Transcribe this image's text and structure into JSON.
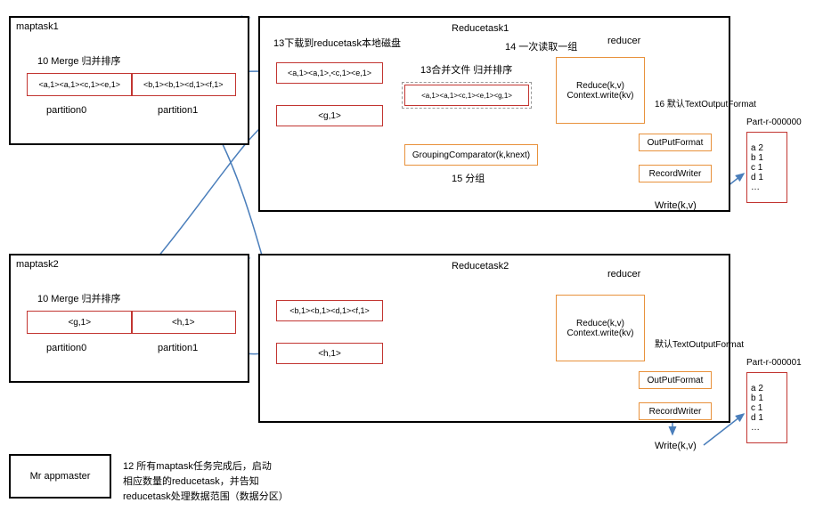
{
  "maptask1": {
    "title": "maptask1",
    "merge_label": "10 Merge 归并排序",
    "data0": "<a,1><a,1><c,1><e,1>",
    "data1": "<b,1><b,1><d,1><f,1>",
    "p0": "partition0",
    "p1": "partition1"
  },
  "maptask2": {
    "title": "maptask2",
    "merge_label": "10 Merge 归并排序",
    "data0": "<g,1>",
    "data1": "<h,1>",
    "p0": "partition0",
    "p1": "partition1"
  },
  "reducetask1": {
    "title": "Reducetask1",
    "l13a": "13下载到reducetask本地磁盘",
    "l14": "14 一次读取一组",
    "l13b": "13合并文件 归并排序",
    "d1": "<a,1><a,1>,<c,1><e,1>",
    "d2": "<g,1>",
    "merged": "<a,1><a,1><c,1><e,1><g,1>",
    "grouping": "GroupingComparator(k,knext)",
    "l15": "15 分组",
    "reducer_label": "reducer",
    "reduce1": "Reduce(k,v)",
    "reduce2": "Context.write(kv)",
    "l16": "16 默认TextOutputFormat",
    "opf": "OutPutFormat",
    "rw": "RecordWriter",
    "write": "Write(k,v)",
    "part": "Part-r-000000",
    "out": [
      "a 2",
      "b 1",
      "c 1",
      "d 1",
      "…"
    ]
  },
  "reducetask2": {
    "title": "Reducetask2",
    "d1": "<b,1><b,1><d,1><f,1>",
    "d2": "<h,1>",
    "reducer_label": "reducer",
    "reduce1": "Reduce(k,v)",
    "reduce2": "Context.write(kv)",
    "l16": "默认TextOutputFormat",
    "opf": "OutPutFormat",
    "rw": "RecordWriter",
    "write": "Write(k,v)",
    "part": "Part-r-000001",
    "out": [
      "a 2",
      "b 1",
      "c 1",
      "d 1",
      "…"
    ]
  },
  "appmaster": {
    "label": "Mr appmaster",
    "note1": "12 所有maptask任务完成后，启动",
    "note2": "相应数量的reducetask，并告知",
    "note3": "reducetask处理数据范围（数据分区）"
  }
}
